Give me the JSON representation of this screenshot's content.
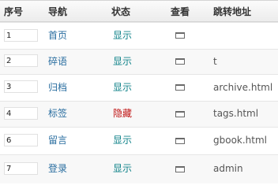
{
  "table": {
    "headers": {
      "order": "序号",
      "nav": "导航",
      "status": "状态",
      "view": "查看",
      "url": "跳转地址"
    },
    "rows": [
      {
        "order": "1",
        "name": "首页",
        "status": "显示",
        "url": ""
      },
      {
        "order": "2",
        "name": "碎语",
        "status": "显示",
        "url": "t"
      },
      {
        "order": "3",
        "name": "归档",
        "status": "显示",
        "url": "archive.html"
      },
      {
        "order": "4",
        "name": "标签",
        "status": "隐藏",
        "url": "tags.html"
      },
      {
        "order": "6",
        "name": "留言",
        "status": "显示",
        "url": "gbook.html"
      },
      {
        "order": "7",
        "name": "登录",
        "status": "显示",
        "url": "admin"
      }
    ],
    "view_icon": "window-icon"
  },
  "colors": {
    "link": "#2a6ea0",
    "status_show": "#11838a",
    "status_hide": "#c01414",
    "row_alt": "#f8f8f8",
    "header_bg": "#f0f0f0"
  }
}
